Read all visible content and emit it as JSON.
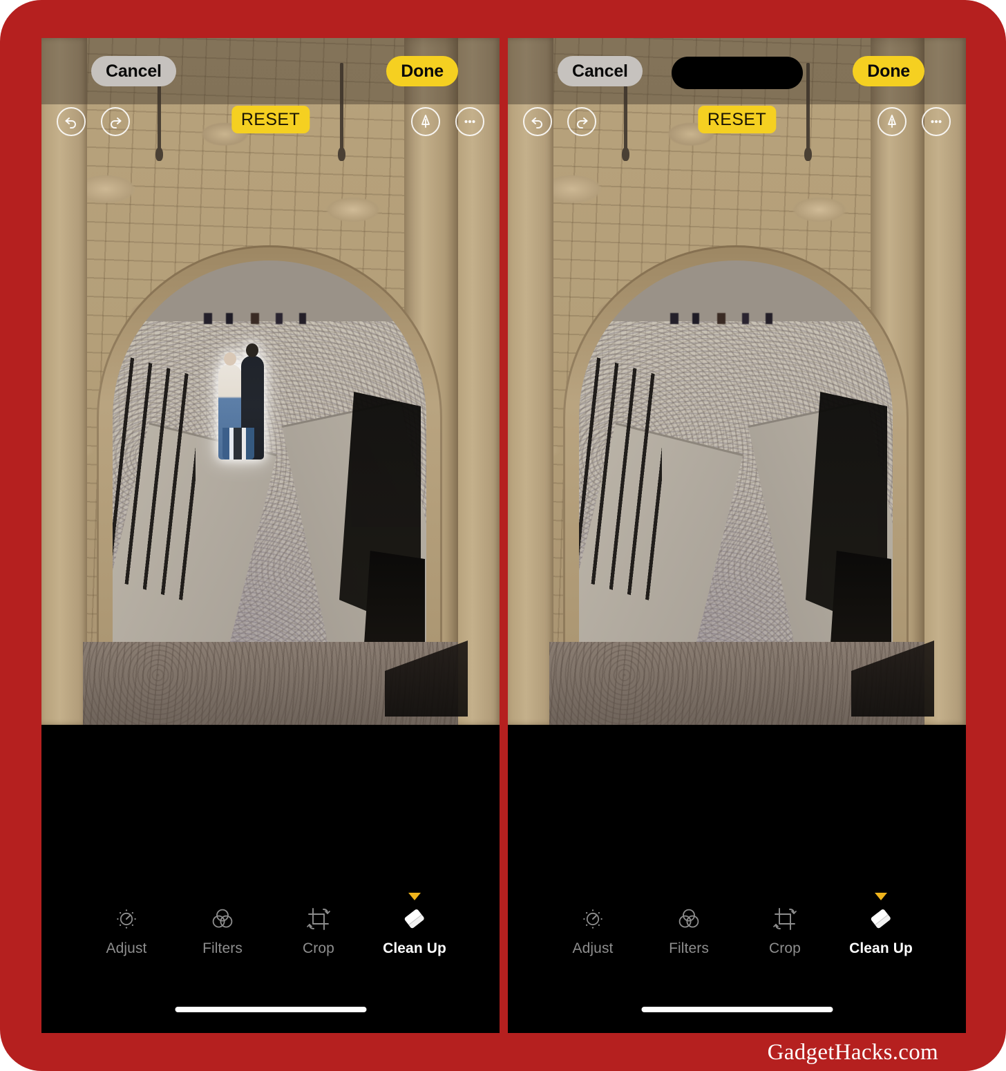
{
  "theme": {
    "frame_color": "#b5201f",
    "accent_yellow": "#f5d021",
    "marker_yellow": "#f0b41c",
    "cancel_gray": "#c6c2be",
    "panel_black": "#000000",
    "active_label": "#ffffff",
    "inactive_label": "#8e8e8e"
  },
  "watermark": {
    "text": "GadgetHacks.com"
  },
  "panels": [
    {
      "id": "before",
      "name": "before-cleanup",
      "show_dynamic_island": false,
      "subject_highlighted": true,
      "topbar": {
        "cancel_label": "Cancel",
        "done_label": "Done"
      },
      "toolrow": {
        "undo_icon": "undo-icon",
        "redo_icon": "redo-icon",
        "reset_label": "RESET",
        "markup_icon": "markup-pen-icon",
        "more_icon": "more-options-icon"
      },
      "tabs": [
        {
          "label": "Adjust",
          "icon": "adjust-icon",
          "active": false
        },
        {
          "label": "Filters",
          "icon": "filters-icon",
          "active": false
        },
        {
          "label": "Crop",
          "icon": "crop-icon",
          "active": false
        },
        {
          "label": "Clean Up",
          "icon": "cleanup-eraser-icon",
          "active": true
        }
      ]
    },
    {
      "id": "after",
      "name": "after-cleanup",
      "show_dynamic_island": true,
      "subject_highlighted": false,
      "topbar": {
        "cancel_label": "Cancel",
        "done_label": "Done"
      },
      "toolrow": {
        "undo_icon": "undo-icon",
        "redo_icon": "redo-icon",
        "reset_label": "RESET",
        "markup_icon": "markup-pen-icon",
        "more_icon": "more-options-icon"
      },
      "tabs": [
        {
          "label": "Adjust",
          "icon": "adjust-icon",
          "active": false
        },
        {
          "label": "Filters",
          "icon": "filters-icon",
          "active": false
        },
        {
          "label": "Crop",
          "icon": "crop-icon",
          "active": false
        },
        {
          "label": "Clean Up",
          "icon": "cleanup-eraser-icon",
          "active": true
        }
      ]
    }
  ]
}
